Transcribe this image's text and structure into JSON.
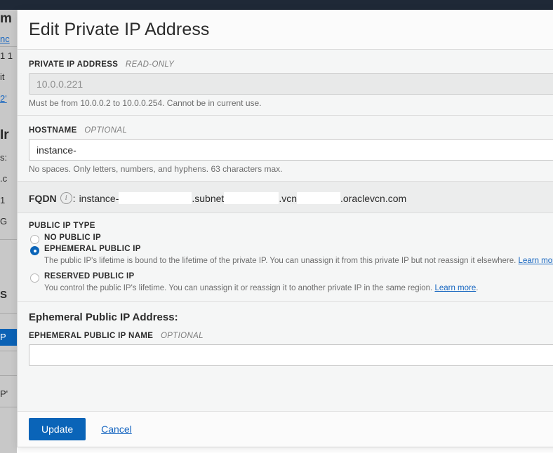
{
  "theme": {
    "topbar_color": "#1f2937",
    "accent_color": "#0a64b8",
    "link_color": "#1565c0",
    "modal_bg": "#f5f6f6",
    "shaded_section_bg": "#eceded"
  },
  "background": {
    "sidebar_fragments": [
      {
        "text": "m",
        "style": "big"
      },
      {
        "text": "nc",
        "style": "link"
      },
      {
        "text": "1 1",
        "style": "plain"
      },
      {
        "text": "it",
        "style": "plain"
      },
      {
        "text": "2'",
        "style": "link"
      },
      {
        "text": "Ir",
        "style": "big"
      },
      {
        "text": "s:",
        "style": "plain"
      },
      {
        "text": ".c",
        "style": "plain"
      },
      {
        "text": "1",
        "style": "plain"
      },
      {
        "text": "G",
        "style": "plain"
      },
      {
        "text": "S",
        "style": "med"
      },
      {
        "text": "P",
        "style": "selected"
      },
      {
        "text": "P'",
        "style": "plain"
      }
    ]
  },
  "modal": {
    "title": "Edit Private IP Address",
    "private_ip": {
      "label": "PRIVATE IP ADDRESS",
      "flag": "READ-ONLY",
      "value": "10.0.0.221",
      "help": "Must be from 10.0.0.2 to 10.0.0.254. Cannot be in current use."
    },
    "hostname": {
      "label": "HOSTNAME",
      "flag": "OPTIONAL",
      "value": "instance-",
      "placeholder": "",
      "help": "No spaces. Only letters, numbers, and hyphens. 63 characters max."
    },
    "fqdn": {
      "label": "FQDN",
      "info_icon": "info-icon",
      "separator": ":",
      "part1": "instance-",
      "part2": ".subnet",
      "part3": ".vcn",
      "part4": ".oraclevcn.com"
    },
    "public_ip_type": {
      "label": "PUBLIC IP TYPE",
      "options": [
        {
          "label": "NO PUBLIC IP",
          "selected": false,
          "description": "",
          "link_text": ""
        },
        {
          "label": "EPHEMERAL PUBLIC IP",
          "selected": true,
          "description": "The public IP's lifetime is bound to the lifetime of the private IP. You can unassign it from this private IP but not reassign it elsewhere.",
          "link_text": "Learn more"
        },
        {
          "label": "RESERVED PUBLIC IP",
          "selected": false,
          "description": "You control the public IP's lifetime. You can unassign it or reassign it to another private IP in the same region.",
          "link_text": "Learn more"
        }
      ]
    },
    "ephemeral_section": {
      "heading": "Ephemeral Public IP Address:",
      "name_label": "EPHEMERAL PUBLIC IP NAME",
      "name_flag": "OPTIONAL",
      "name_value": "",
      "name_placeholder": ""
    },
    "footer": {
      "update_label": "Update",
      "cancel_label": "Cancel"
    }
  }
}
